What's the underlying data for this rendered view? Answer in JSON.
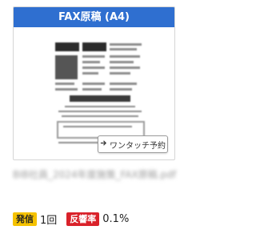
{
  "card": {
    "title": "FAX原稿 (A4)",
    "reserve_button": {
      "icon": "arrow-right-icon",
      "label": "ワンタッチ予約"
    }
  },
  "file": {
    "name": "BIB社員_2024年度施策_FAX原稿.pdf"
  },
  "stats": {
    "send_label": "発信",
    "send_value": "1回",
    "response_label": "反響率",
    "response_value": "0.1%"
  },
  "colors": {
    "header_bg": "#2f6fd0",
    "send_badge": "#f5c200",
    "response_badge": "#d9222a"
  }
}
